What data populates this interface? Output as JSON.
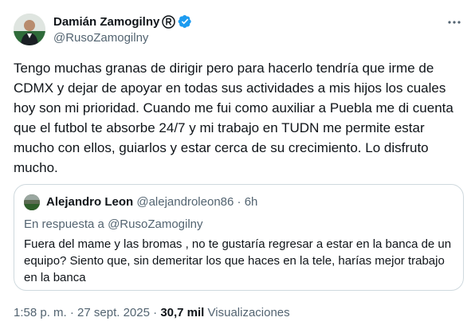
{
  "author": {
    "name": "Damián Zamogilny",
    "handle": "@RusoZamogilny",
    "avatar_icon": "person-avatar",
    "verified_color": "#1d9bf0"
  },
  "tweet": {
    "text": "Tengo muchas granas de dirigir pero para hacerlo tendría que irme de CDMX y dejar de apoyar en todas sus actividades a mis hijos los cuales hoy son mi prioridad. Cuando me fui como auxiliar a Puebla me di cuenta que el futbol te absorbe 24/7 y mi trabajo en TUDN me permite estar mucho con ellos, guiarlos y estar cerca de su crecimiento. Lo disfruto mucho."
  },
  "quote": {
    "name": "Alejandro Leon",
    "handle": "@alejandroleon86",
    "separator": "·",
    "time": "6h",
    "reply_prefix": "En respuesta a",
    "reply_to": "@RusoZamogilny",
    "text": "Fuera del mame y las bromas , no te gustaría regresar a estar en la banca de un equipo? Siento que, sin demeritar los que haces en la tele, harías mejor trabajo en la banca"
  },
  "footer": {
    "time": "1:58 p. m.",
    "separator": "·",
    "date": "27 sept. 2025",
    "views_count": "30,7 mil",
    "views_label": "Visualizaciones"
  }
}
